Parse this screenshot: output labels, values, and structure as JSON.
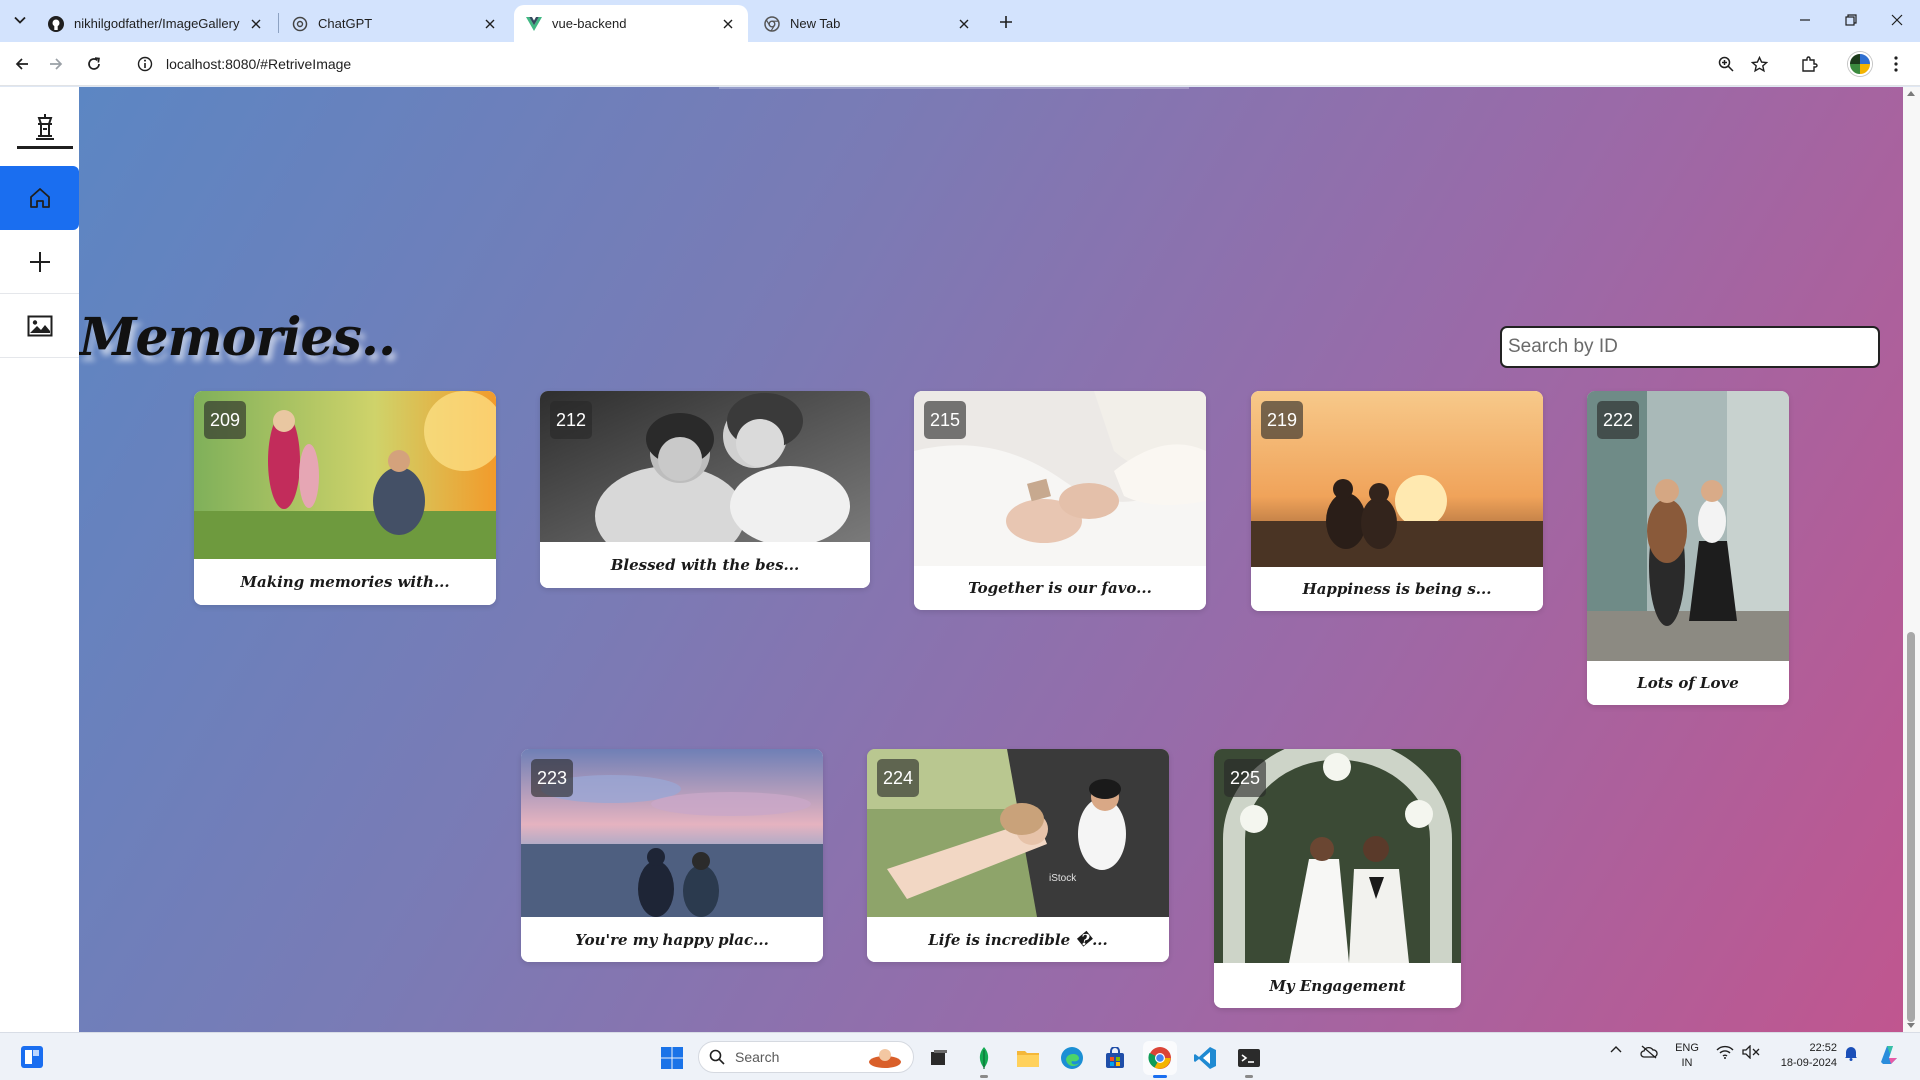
{
  "browser": {
    "tabs": [
      {
        "title": "nikhilgodfather/ImageGallery",
        "icon": "github-icon"
      },
      {
        "title": "ChatGPT",
        "icon": "chatgpt-icon"
      },
      {
        "title": "vue-backend",
        "icon": "vue-icon",
        "active": true
      },
      {
        "title": "New Tab",
        "icon": "chrome-icon"
      }
    ],
    "url": "localhost:8080/#RetriveImage"
  },
  "sidebar": {
    "items": [
      {
        "name": "logo",
        "icon": "lamp-logo-icon"
      },
      {
        "name": "home",
        "icon": "home-icon",
        "active": true
      },
      {
        "name": "add",
        "icon": "plus-icon"
      },
      {
        "name": "gallery",
        "icon": "image-icon"
      }
    ]
  },
  "page": {
    "heading": "Memories..",
    "search_placeholder": "Search by ID"
  },
  "cards": [
    {
      "id": "209",
      "caption": "Making memories with...",
      "scene": "family in sunny park"
    },
    {
      "id": "212",
      "caption": "Blessed with the bes...",
      "scene": "black and white girls laughing"
    },
    {
      "id": "215",
      "caption": "Together is our favo...",
      "scene": "holding hands on bed"
    },
    {
      "id": "219",
      "caption": "Happiness is being s...",
      "scene": "couple at sunset"
    },
    {
      "id": "222",
      "caption": "Lots of Love",
      "scene": "couple holding hands street"
    },
    {
      "id": "223",
      "caption": "You're my happy plac...",
      "scene": "couple on beach at dusk"
    },
    {
      "id": "224",
      "caption": "Life is incredible �...",
      "scene": "couple playful in car trunk"
    },
    {
      "id": "225",
      "caption": "My Engagement",
      "scene": "wedding couple under floral arch"
    }
  ],
  "taskbar": {
    "search_label": "Search",
    "language": [
      "ENG",
      "IN"
    ],
    "time": "22:52",
    "date": "18-09-2024"
  },
  "colors": {
    "accent": "#1a6ef0",
    "gradient_start": "#5c86c3",
    "gradient_end": "#c0568f"
  }
}
